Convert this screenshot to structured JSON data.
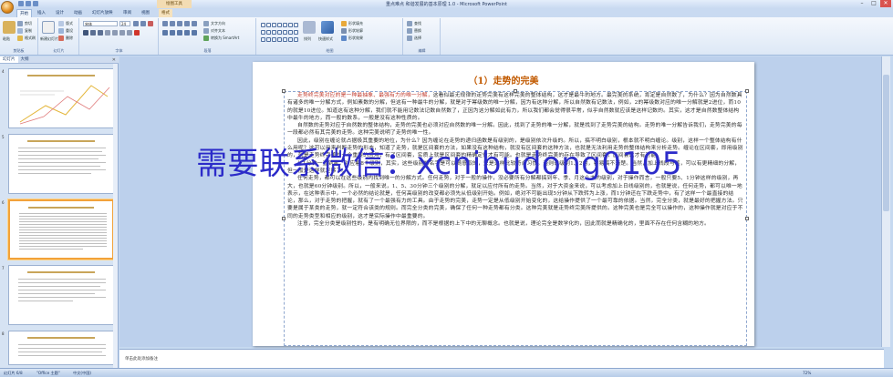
{
  "window": {
    "title": "重点难点 和谐发展的基本原理 1.0 - Microsoft PowerPoint",
    "context_tab_title": "绘图工具"
  },
  "tabs": [
    {
      "label": "开始"
    },
    {
      "label": "插入"
    },
    {
      "label": "设计"
    },
    {
      "label": "动画"
    },
    {
      "label": "幻灯片放映"
    },
    {
      "label": "审阅"
    },
    {
      "label": "视图"
    },
    {
      "label": "格式"
    }
  ],
  "ribbon": {
    "paste": "粘贴",
    "cut": "剪切",
    "copy": "复制",
    "format_painter": "格式刷",
    "clipboard": "剪贴板",
    "new_slide": "新建幻灯片",
    "layout": "版式",
    "reset": "重设",
    "delete": "删除",
    "slides": "幻灯片",
    "font_name": "宋体",
    "font_size": "24",
    "font_group": "字体",
    "para_group": "段落",
    "text_direction": "文字方向",
    "align_text": "对齐文本",
    "smartart": "转换为 SmartArt",
    "drawing_group": "绘图",
    "arrange": "排列",
    "quick_styles": "快速样式",
    "shape_fill": "形状填充",
    "shape_outline": "形状轮廓",
    "shape_effects": "形状效果",
    "find": "查找",
    "replace": "替换",
    "select": "选择",
    "editing_group": "编辑"
  },
  "panel": {
    "tab_outline": "幻灯片",
    "tab_slides": "大纲",
    "thumbs": [
      {
        "num": "4"
      },
      {
        "num": "5"
      },
      {
        "num": "6"
      },
      {
        "num": "7"
      },
      {
        "num": "8"
      }
    ]
  },
  "slide": {
    "title": "（1）走势的完美",
    "paragraphs": [
      {
        "red": "走势终完美对应的是一种最抽象、最强有力的唯一分解，",
        "text": "这看似最无规律的走势完美有这样完美的整体结构，这才是最牛的地方。最完美的系统，肯定是自然数了，为什么？因为自然数具有诸多的唯一分解方式，例如素数的分解，但这有一种最牛的分解，就是对于幂级数的唯一分解，因为有这种分解，所以自然数有记数法，例如，2的幂级数对应的唯一分解就是2进位，而10的就是10进位。知道这有这种分解，我们就不能用记数法记数自然数了，正因为这分解如此有力，所以我们都会觉得很平常，似乎自然数就应该是这样记数的。其实，这才是自然数整体结构中最牛的地方，而一般的数系，一般是没有这种性质的。"
      },
      {
        "red": "",
        "text": "自然数的走势对应于自然数的整体结构，走势的完美也必须对应自然数的唯一分解。因此，找到了走势的唯一分解，就是找到了走势完美的结构。走势的唯一分解告诉我们，走势完美的每一段都必然有其完美的走势。这种完美说明了走势的唯一性。"
      },
      {
        "red": "",
        "text": "因此，级别在缠论就占据极其重要的地位，为什么？因为缠论在走势的递归函数是有级别的，是级别依次升级的。所以，搞不明白级别，根本就不明白缠论。级别，这样一个整体结构有什么用呢？这可以用来判断走势的形态，知道了走势，就是区间套的方法，如果没有这种结构，就没有区间套的这种方法，也就是无法利用走势的整体结构来分析走势。缠论在区间套，即用级别的，就是走势终完美的一个重要的应用，有了区间套，实质上就是区间套的精确定位才有可能。也就是走势终完美的存在导致了区间套，区间套这才有可能。"
      },
      {
        "red": "",
        "text": "从1分钟一直到年，对应着8个级别，其实，这些级别的名字是可以随意取的，只是这样比较符合习惯。否则说级别1、2的，容易搞不清楚。当然，加上线段与笔，可以有更精细的分解，但一般是这样就足够了。"
      },
      {
        "red": "",
        "text": "任何走势，都可以在这些级别内找到唯一的分解方式。任何走势，对于一般的操作，没必要所有分解都搞到年、季、月这么大的级别，对于操作而言，一般只要5、1分钟这样的级别，再大，也就是60分钟级别。所以，一般来说，1、5、30分钟三个级别的分解，就足以应付所有的走势。当然，对于大资金来说，可以考虑加上日线级别的，也就是说，任何走势，都可以唯一地表示，在这种表示中，一个必然的结论就是，任何高级别的改变都必须先从低级别开始。例如，绝对不可能出现5分钟从下跌转为上涨，而1分钟还在下跌走势中，有了这样一个最直接的结论，那么，对于走势的把握，就有了一个最强有力的工具。由于走势的完美，走势一定是从低级别开始变化的，这给操作提供了一个最可靠的依据。当然，完全分类，就是最好的把握方法。只要是属于某类的走势，就一定符合该类的规则。而完全分类的完美，确保了任何一种走势都有分类。这种完美就是走势终完美所提供的。这种完美也是完全可以操作的，这种操作就是对应于不同的走势类型和相应的级别，这才是实际操作中最重要的。"
      },
      {
        "red": "",
        "text": "注意，完全分类是级别性的，是有明确无位界限的，而不是根据的上下中的无聊概念。也就是说，理论完全是数学化的，因此而就是精确化的，里面不存在任何含糊的地方。"
      }
    ]
  },
  "watermark": "需要联系微信：xcnibudong0105",
  "notes": {
    "placeholder": "单击此处添加备注"
  },
  "status": {
    "slide_info": "幻灯片 6/8",
    "theme": "\"Office 主题\"",
    "language": "中文(中国)",
    "zoom": "72%"
  }
}
